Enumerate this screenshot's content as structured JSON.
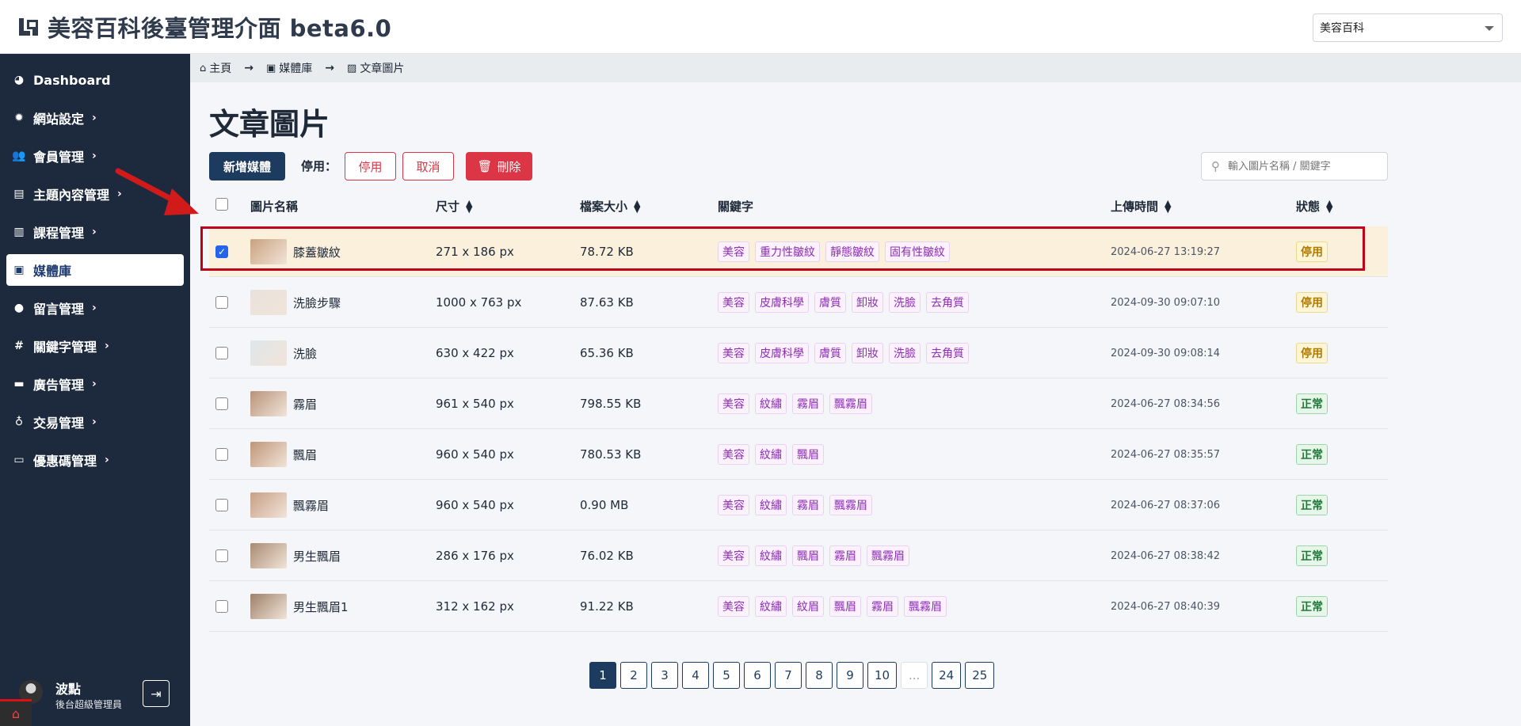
{
  "app": {
    "title": "美容百科後臺管理介面 beta6.0",
    "site_selector": "美容百科"
  },
  "sidebar": {
    "items": [
      {
        "label": "Dashboard",
        "icon": "dashboard-icon",
        "chevron": false
      },
      {
        "label": "網站設定",
        "icon": "gear-icon",
        "chevron": true
      },
      {
        "label": "會員管理",
        "icon": "users-icon",
        "chevron": true
      },
      {
        "label": "主題內容管理",
        "icon": "newspaper-icon",
        "chevron": true
      },
      {
        "label": "課程管理",
        "icon": "book-icon",
        "chevron": true
      },
      {
        "label": "媒體庫",
        "icon": "images-icon",
        "chevron": false,
        "active": true
      },
      {
        "label": "留言管理",
        "icon": "comment-icon",
        "chevron": true
      },
      {
        "label": "關鍵字管理",
        "icon": "hashtag-icon",
        "chevron": true
      },
      {
        "label": "廣告管理",
        "icon": "ad-icon",
        "chevron": true
      },
      {
        "label": "交易管理",
        "icon": "money-bag-icon",
        "chevron": true
      },
      {
        "label": "優惠碼管理",
        "icon": "ticket-icon",
        "chevron": true
      }
    ],
    "user": {
      "name": "波點",
      "role": "後台超級管理員"
    }
  },
  "breadcrumb": [
    {
      "label": "主頁",
      "icon": "home-icon"
    },
    {
      "label": "媒體庫",
      "icon": "images-icon"
    },
    {
      "label": "文章圖片",
      "icon": "image-icon"
    }
  ],
  "page": {
    "title": "文章圖片",
    "add_button": "新增媒體",
    "disable_label": "停用：",
    "disable_button": "停用",
    "cancel_button": "取消",
    "delete_button": "刪除",
    "search_placeholder": "輸入圖片名稱 / 關鍵字"
  },
  "table": {
    "columns": [
      "圖片名稱",
      "尺寸",
      "檔案大小",
      "關鍵字",
      "上傳時間",
      "狀態"
    ],
    "rows": [
      {
        "name": "膝蓋皺紋",
        "size": "271 x 186 px",
        "filesize": "78.72 KB",
        "keywords": [
          "美容",
          "重力性皺紋",
          "靜態皺紋",
          "固有性皺紋"
        ],
        "uploaded": "2024-06-27 13:19:27",
        "status": "停用",
        "status_type": "off",
        "selected": true,
        "thumb_color": "#c9a27f"
      },
      {
        "name": "洗臉步驟",
        "size": "1000 x 763 px",
        "filesize": "87.63 KB",
        "keywords": [
          "美容",
          "皮膚科學",
          "膚質",
          "卸妝",
          "洗臉",
          "去角質"
        ],
        "uploaded": "2024-09-30 09:07:10",
        "status": "停用",
        "status_type": "off",
        "selected": false,
        "thumb_color": "#e8e2dc"
      },
      {
        "name": "洗臉",
        "size": "630 x 422 px",
        "filesize": "65.36 KB",
        "keywords": [
          "美容",
          "皮膚科學",
          "膚質",
          "卸妝",
          "洗臉",
          "去角質"
        ],
        "uploaded": "2024-09-30 09:08:14",
        "status": "停用",
        "status_type": "off",
        "selected": false,
        "thumb_color": "#dfe6ea"
      },
      {
        "name": "霧眉",
        "size": "961 x 540 px",
        "filesize": "798.55 KB",
        "keywords": [
          "美容",
          "紋繡",
          "霧眉",
          "飄霧眉"
        ],
        "uploaded": "2024-06-27 08:34:56",
        "status": "正常",
        "status_type": "on",
        "selected": false,
        "thumb_color": "#b8937a"
      },
      {
        "name": "飄眉",
        "size": "960 x 540 px",
        "filesize": "780.53 KB",
        "keywords": [
          "美容",
          "紋繡",
          "飄眉"
        ],
        "uploaded": "2024-06-27 08:35:57",
        "status": "正常",
        "status_type": "on",
        "selected": false,
        "thumb_color": "#bf9679"
      },
      {
        "name": "飄霧眉",
        "size": "960 x 540 px",
        "filesize": "0.90 MB",
        "keywords": [
          "美容",
          "紋繡",
          "霧眉",
          "飄霧眉"
        ],
        "uploaded": "2024-06-27 08:37:06",
        "status": "正常",
        "status_type": "on",
        "selected": false,
        "thumb_color": "#c79f86"
      },
      {
        "name": "男生飄眉",
        "size": "286 x 176 px",
        "filesize": "76.02 KB",
        "keywords": [
          "美容",
          "紋繡",
          "飄眉",
          "霧眉",
          "飄霧眉"
        ],
        "uploaded": "2024-06-27 08:38:42",
        "status": "正常",
        "status_type": "on",
        "selected": false,
        "thumb_color": "#a98a72"
      },
      {
        "name": "男生飄眉1",
        "size": "312 x 162 px",
        "filesize": "91.22 KB",
        "keywords": [
          "美容",
          "紋繡",
          "紋眉",
          "飄眉",
          "霧眉",
          "飄霧眉"
        ],
        "uploaded": "2024-06-27 08:40:39",
        "status": "正常",
        "status_type": "on",
        "selected": false,
        "thumb_color": "#9e806a"
      }
    ]
  },
  "pagination": {
    "pages": [
      "1",
      "2",
      "3",
      "4",
      "5",
      "6",
      "7",
      "8",
      "9",
      "10",
      "...",
      "24",
      "25"
    ],
    "current": "1"
  },
  "colors": {
    "sidebar_bg": "#1d2a3e",
    "primary": "#1d3a5f",
    "danger": "#dc3545",
    "highlight_frame": "#c0001a",
    "keyword_text": "#8e2db5"
  }
}
